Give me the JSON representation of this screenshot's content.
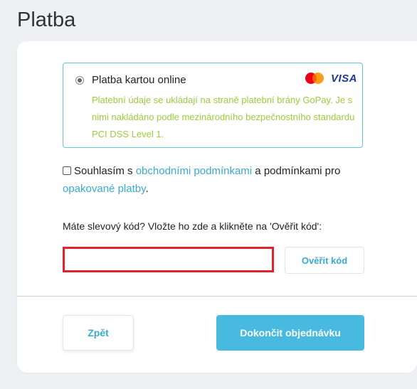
{
  "page": {
    "title": "Platba"
  },
  "payment_option": {
    "title": "Platba kartou online",
    "description": "Platební údaje se ukládají na straně platební brány GoPay. Je s nimi nakládáno podle mezinárodního bezpečnostního standardu PCI DSS Level 1.",
    "selected": true,
    "icons": [
      "mastercard-logo",
      "visa-logo"
    ],
    "visa_text": "VISA",
    "accent_color": "#5fc8d8",
    "description_color": "#9ccc3c"
  },
  "terms": {
    "prefix": "Souhlasím s ",
    "link1": "obchodními podmínkami",
    "middle": " a podmínkami pro ",
    "link2": "opakované platby",
    "suffix": ".",
    "checked": false
  },
  "promo": {
    "label": "Máte slevový kód? Vložte ho zde a klikněte na 'Ověřit kód':",
    "input_value": "",
    "verify_label": "Ověřit kód",
    "highlight_color": "#e0232b"
  },
  "footer": {
    "back_label": "Zpět",
    "finish_label": "Dokončit objednávku",
    "primary_color": "#48b9df",
    "link_color": "#3aa9d6"
  }
}
